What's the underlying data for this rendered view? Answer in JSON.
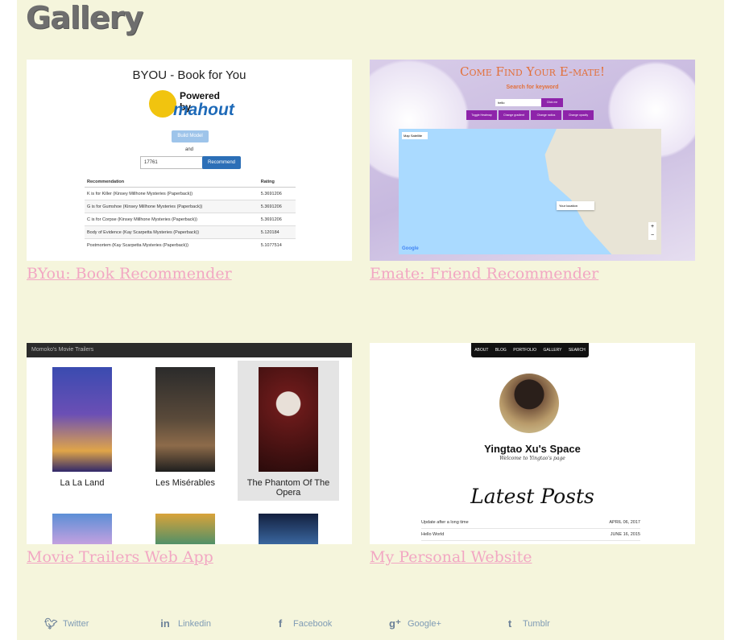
{
  "page": {
    "title": "Gallery"
  },
  "cards": [
    {
      "link": "BYou: Book Recommender"
    },
    {
      "link": "Emate: Friend Recommender"
    },
    {
      "link": "Movie Trailers Web App"
    },
    {
      "link": "My Personal Website"
    }
  ],
  "byou": {
    "title": "BYOU - Book for You",
    "powered": "Powered by",
    "brand": "mahout",
    "build": "Build Model",
    "and": "and",
    "input": "17761",
    "recommend": "Recommend",
    "headers": [
      "Recommendation",
      "Rating"
    ],
    "rows": [
      [
        "K is for Killer (Kinsey Millhone Mysteries (Paperback))",
        "5.3691206"
      ],
      [
        "G is for Gumshoe (Kinsey Millhone Mysteries (Paperback))",
        "5.3691206"
      ],
      [
        "C is for Corpse (Kinsey Millhone Mysteries (Paperback))",
        "5.3691206"
      ],
      [
        "Body of Evidence (Kay Scarpetta Mysteries (Paperback))",
        "5.120184"
      ],
      [
        "Postmortem (Kay Scarpetta Mysteries (Paperback))",
        "5.1077514"
      ]
    ]
  },
  "emate": {
    "heading": "Come Find Your E-mate!",
    "sub": "Search for keyword",
    "input": "hello",
    "button": "Click me",
    "toggles": [
      "Toggle Heatmap",
      "Change gradient",
      "Change radius",
      "Change opacity"
    ],
    "maptab": "Map Satellite",
    "pin": "Your location",
    "google": "Google"
  },
  "movies": {
    "bar": "Momoko's Movie Trailers",
    "titles": [
      "La La Land",
      "Les Misérables",
      "The Phantom Of The Opera"
    ]
  },
  "personal": {
    "nav": [
      "ABOUT",
      "BLOG",
      "PORTFOLIO",
      "GALLERY",
      "SEARCH"
    ],
    "name": "Yingtao Xu's Space",
    "tagline": "Welcome to Yingtao's page",
    "latest": "Latest Posts",
    "posts": [
      {
        "title": "Update after a long time",
        "date": "APRIL 06, 2017"
      },
      {
        "title": "Hello World",
        "date": "JUNE 16, 2015"
      }
    ]
  },
  "footer": [
    {
      "label": "Twitter",
      "icon": "twitter-icon"
    },
    {
      "label": "Linkedin",
      "icon": "linkedin-icon"
    },
    {
      "label": "Facebook",
      "icon": "facebook-icon"
    },
    {
      "label": "Google+",
      "icon": "google-plus-icon"
    },
    {
      "label": "Tumblr",
      "icon": "tumblr-icon"
    }
  ]
}
